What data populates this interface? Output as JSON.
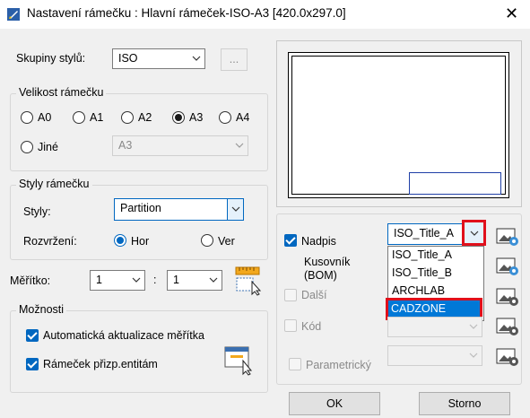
{
  "window": {
    "title": "Nastavení rámečku  :  Hlavní rámeček-ISO-A3 [420.0x297.0]"
  },
  "style_groups": {
    "label": "Skupiny stylů:",
    "value": "ISO",
    "browse_label": "..."
  },
  "frame_size": {
    "legend": "Velikost rámečku",
    "options": [
      "A0",
      "A1",
      "A2",
      "A3",
      "A4"
    ],
    "selected": "A3",
    "other_label": "Jiné",
    "other_value": "A3"
  },
  "frame_styles": {
    "legend": "Styly rámečku",
    "styles_label": "Styly:",
    "styles_value": "Partition",
    "layout_label": "Rozvržení:",
    "horizontal": "Hor",
    "vertical": "Ver",
    "selected": "Hor"
  },
  "scale": {
    "label": "Měřítko:",
    "left": "1",
    "separator": ":",
    "right": "1"
  },
  "options": {
    "legend": "Možnosti",
    "auto_update": "Automatická aktualizace měřítka",
    "fit_entities": "Rámeček přizp.entitám"
  },
  "right_panel": {
    "title_block_label": "Nadpis",
    "title_block_value": "ISO_Title_A",
    "bom_label": "Kusovník\n(BOM)",
    "other_label": "Další",
    "code_label": "Kód",
    "parametric_label": "Parametrický"
  },
  "dropdown": {
    "items": [
      "ISO_Title_A",
      "ISO_Title_B",
      "ARCHLAB",
      "CADZONE"
    ],
    "selected": "CADZONE"
  },
  "footer": {
    "ok_label": "OK",
    "cancel_label": "Storno"
  },
  "colors": {
    "accent": "#0067c0",
    "highlight": "#e0101c",
    "selection": "#0078d7"
  }
}
